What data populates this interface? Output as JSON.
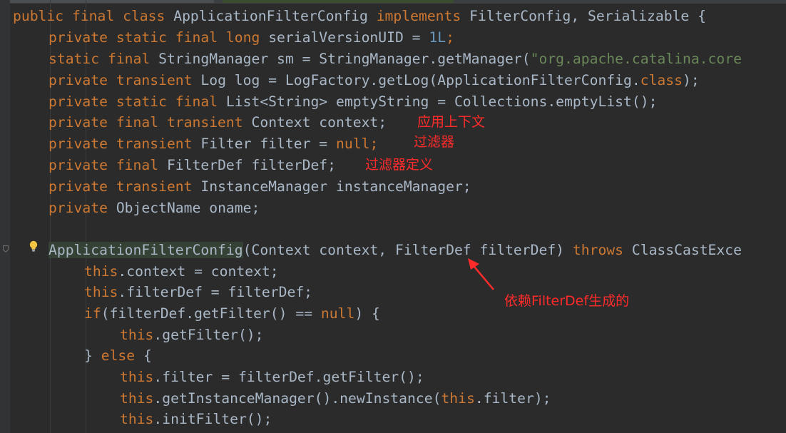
{
  "code": {
    "class_decl": {
      "kw1": "public final class ",
      "name": "ApplicationFilterConfig ",
      "kw2": "implements ",
      "ifaces": "FilterConfig, Serializable {"
    },
    "serial": {
      "kw": "private static final long ",
      "name": "serialVersionUID = ",
      "num": "1L",
      "end": ";"
    },
    "sm": {
      "kw": "static final ",
      "rest": "StringManager sm = StringManager.getManager(",
      "str": "\"org.apache.catalina.core"
    },
    "log": {
      "kw": "private transient ",
      "rest1": "Log log = LogFactory.getLog(ApplicationFilterConfig.",
      "kw2": "class",
      "rest2": ");"
    },
    "empty": {
      "kw": "private static final ",
      "rest": "List<String> emptyString = Collections.emptyList();"
    },
    "context": {
      "kw": "private final transient ",
      "rest": "Context context;"
    },
    "filter": {
      "kw": "private transient ",
      "rest": "Filter filter = ",
      "kw2": "null",
      "end": ";"
    },
    "filterdef": {
      "kw": "private final ",
      "rest": "FilterDef filterDef;"
    },
    "instmgr": {
      "kw": "private transient ",
      "rest": "InstanceManager instanceManager;"
    },
    "oname": {
      "kw": "private ",
      "rest": "ObjectName oname;"
    },
    "ctor": {
      "name": "ApplicationFilterConfig",
      "params": "(Context context, FilterDef filterDef) ",
      "kw": "throws ",
      "exc": "ClassCastExce"
    },
    "l12": {
      "kw": "this",
      "rest": ".context = context;"
    },
    "l13": {
      "kw": "this",
      "rest": ".filterDef = filterDef;"
    },
    "l14": {
      "kw": "if",
      "rest": "(filterDef.getFilter() == ",
      "kw2": "null",
      "end": ") {"
    },
    "l15": {
      "kw": "this",
      "rest": ".getFilter();"
    },
    "l16": {
      "pre": "} ",
      "kw": "else",
      "end": " {"
    },
    "l17": {
      "kw": "this",
      "rest": ".filter = filterDef.getFilter();"
    },
    "l18": {
      "kw": "this",
      "rest": ".getInstanceManager().newInstance(",
      "kw2": "this",
      "end": ".filter);"
    },
    "l19": {
      "kw": "this",
      "rest": ".initFilter();"
    }
  },
  "annotations": {
    "context": "应用上下文",
    "filter": "过滤器",
    "filterdef": "过滤器定义",
    "arrow_note": "依赖FilterDef生成的"
  },
  "icons": {
    "bulb": "lightbulb-icon",
    "fold": "fold-marker-icon",
    "arrow": "red-arrow-icon"
  },
  "colors": {
    "background": "#2b2b2b",
    "keyword": "#cc7832",
    "text": "#a9b7c6",
    "number": "#6897bb",
    "string": "#6a8759",
    "annotation": "#ff2b2b"
  }
}
